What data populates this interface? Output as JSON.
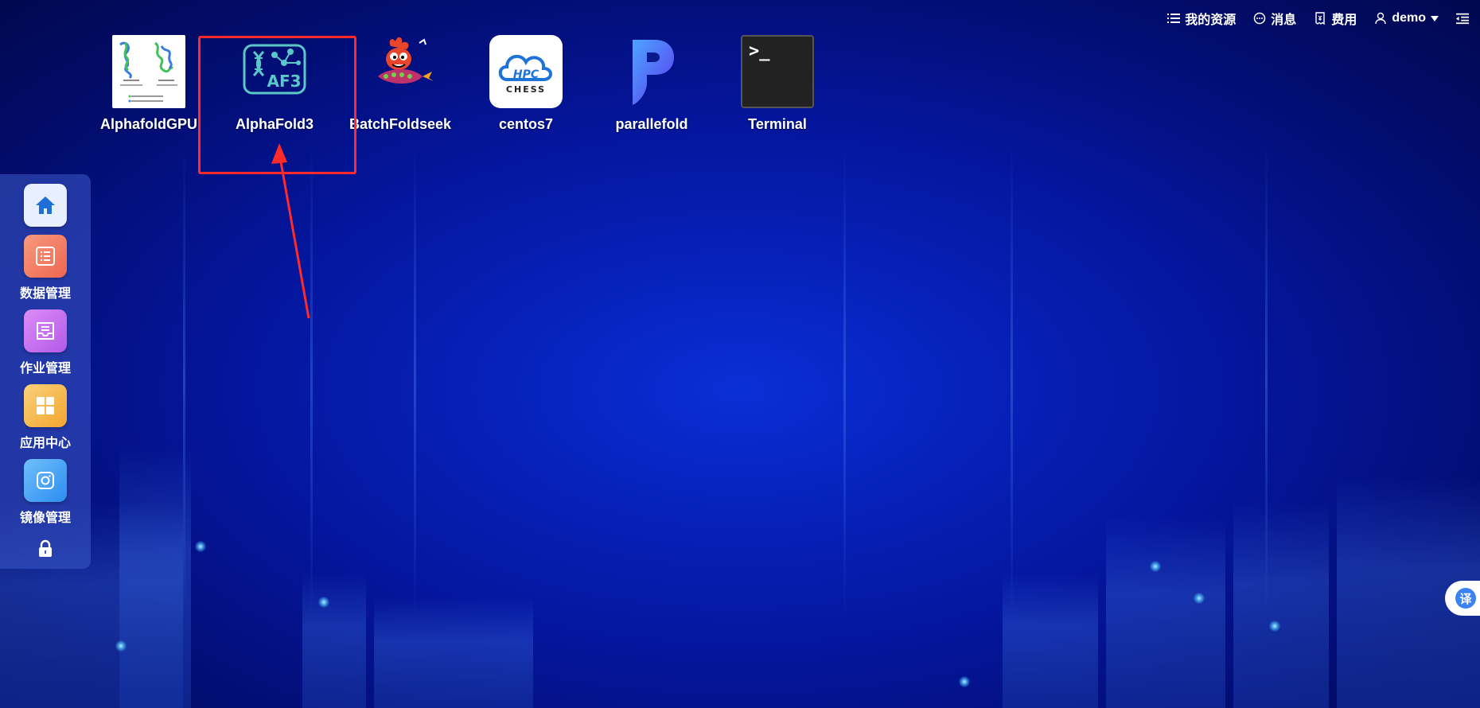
{
  "topbar": {
    "resources": "我的资源",
    "messages": "消息",
    "billing": "费用",
    "user": "demo"
  },
  "apps": [
    {
      "label": "AlphafoldGPU",
      "icon": "protein-structure-image"
    },
    {
      "label": "AlphaFold3",
      "icon": "af3-dna-icon",
      "icon_text": "AF3"
    },
    {
      "label": "BatchFoldseek",
      "icon": "rocket-mascot-icon"
    },
    {
      "label": "centos7",
      "icon": "hpc-chess-cloud-icon",
      "icon_text": "HPC",
      "icon_subtext": "CHESS"
    },
    {
      "label": "parallefold",
      "icon": "p-logo-icon"
    },
    {
      "label": "Terminal",
      "icon": "terminal-icon",
      "icon_text": ">_"
    }
  ],
  "dock": [
    {
      "label": "",
      "icon": "home-icon",
      "color": "#e8f0ff"
    },
    {
      "label": "数据管理",
      "icon": "data-list-icon",
      "color": "#f27a62"
    },
    {
      "label": "作业管理",
      "icon": "job-tray-icon",
      "color": "#c36cf0"
    },
    {
      "label": "应用中心",
      "icon": "app-grid-icon",
      "color": "#f6b64a"
    },
    {
      "label": "镜像管理",
      "icon": "camera-icon",
      "color": "#3da0f5"
    }
  ],
  "translate": {
    "label": "译"
  },
  "colors": {
    "highlight": "#ff2a2a",
    "accent": "#3b82f6"
  }
}
